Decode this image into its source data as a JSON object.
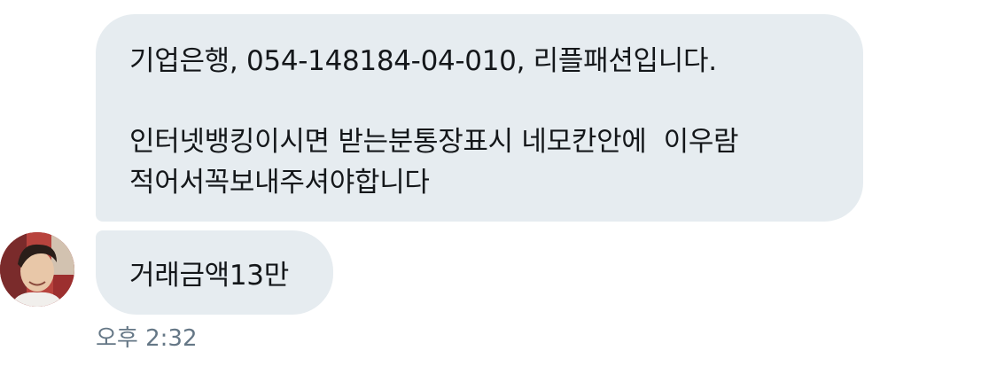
{
  "messages": [
    {
      "lines": [
        "기업은행, 054-148184-04-010, 리플패션입니다.",
        "인터넷뱅킹이시면 받는분통장표시 네모칸안에  이우람",
        "적어서꼭보내주셔야합니다"
      ]
    },
    {
      "lines": [
        "거래금액13만"
      ]
    }
  ],
  "timestamp": "오후 2:32",
  "colors": {
    "bubble_bg": "#e6ecf0",
    "text": "#14171a",
    "timestamp": "#657786"
  }
}
